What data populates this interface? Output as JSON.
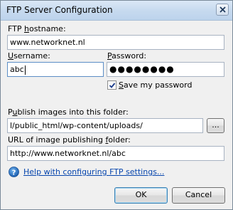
{
  "window": {
    "title": "FTP Server Configuration"
  },
  "hostname": {
    "label_pre": "FTP ",
    "label_access": "h",
    "label_post": "ostname:",
    "value": "www.networknet.nl"
  },
  "username": {
    "label_access": "U",
    "label_post": "sername:",
    "value": "abc"
  },
  "password": {
    "label_access": "P",
    "label_post": "assword:",
    "value": "●●●●●●●●"
  },
  "save_password": {
    "label_access": "S",
    "label_post": "ave my password",
    "checked": true
  },
  "publish_folder": {
    "label_pre": "P",
    "label_access": "u",
    "label_post": "blish images into this folder:",
    "value": "l/public_html/wp-content/uploads/",
    "browse_label": "..."
  },
  "url_folder": {
    "label_pre": "URL of image publishing ",
    "label_access": "f",
    "label_post": "older:",
    "value": "http://www.networknet.nl/abc"
  },
  "help": {
    "label": "Help with configuring FTP settings..."
  },
  "buttons": {
    "ok": "OK",
    "cancel": "Cancel"
  }
}
